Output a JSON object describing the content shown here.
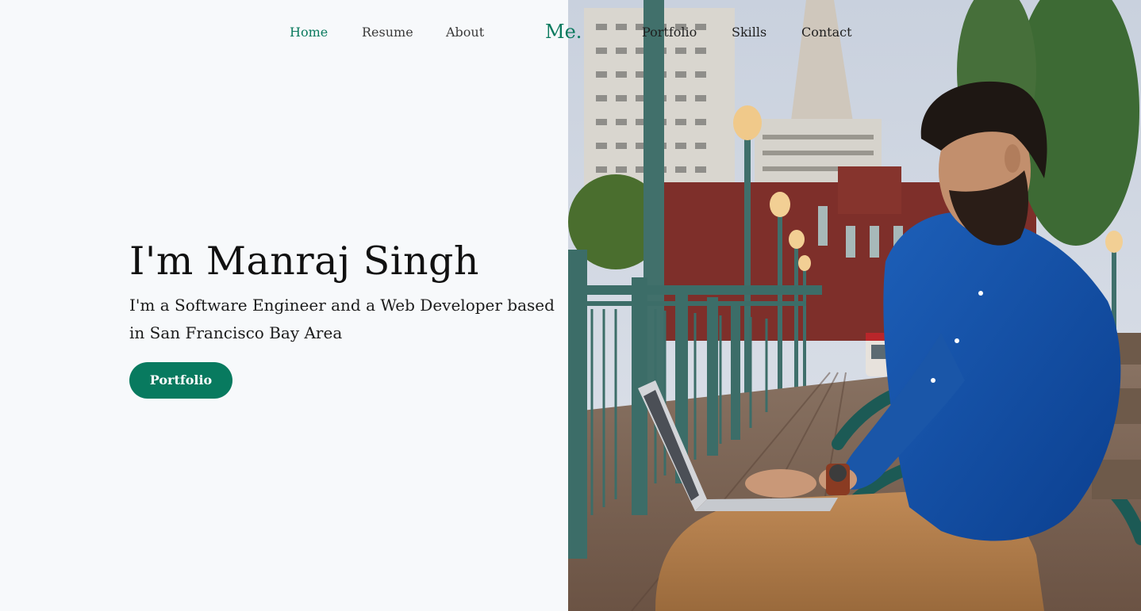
{
  "nav": {
    "left_items": [
      {
        "label": "Home",
        "active": true
      },
      {
        "label": "Resume",
        "active": false
      },
      {
        "label": "About",
        "active": false
      }
    ],
    "brand": "Me.",
    "right_items": [
      {
        "label": "Portfolio",
        "active": false
      },
      {
        "label": "Skills",
        "active": false
      },
      {
        "label": "Contact",
        "active": false
      }
    ]
  },
  "hero": {
    "title": "I'm Manraj Singh",
    "subtitle": "I'm a Software Engineer and a Web Developer based in San Francisco Bay Area",
    "button_label": "Portfolio"
  },
  "colors": {
    "accent": "#087a5f",
    "background": "#f7f9fb",
    "text": "#111111"
  },
  "photo": {
    "subject": "man-with-laptop-on-bench-photo"
  }
}
